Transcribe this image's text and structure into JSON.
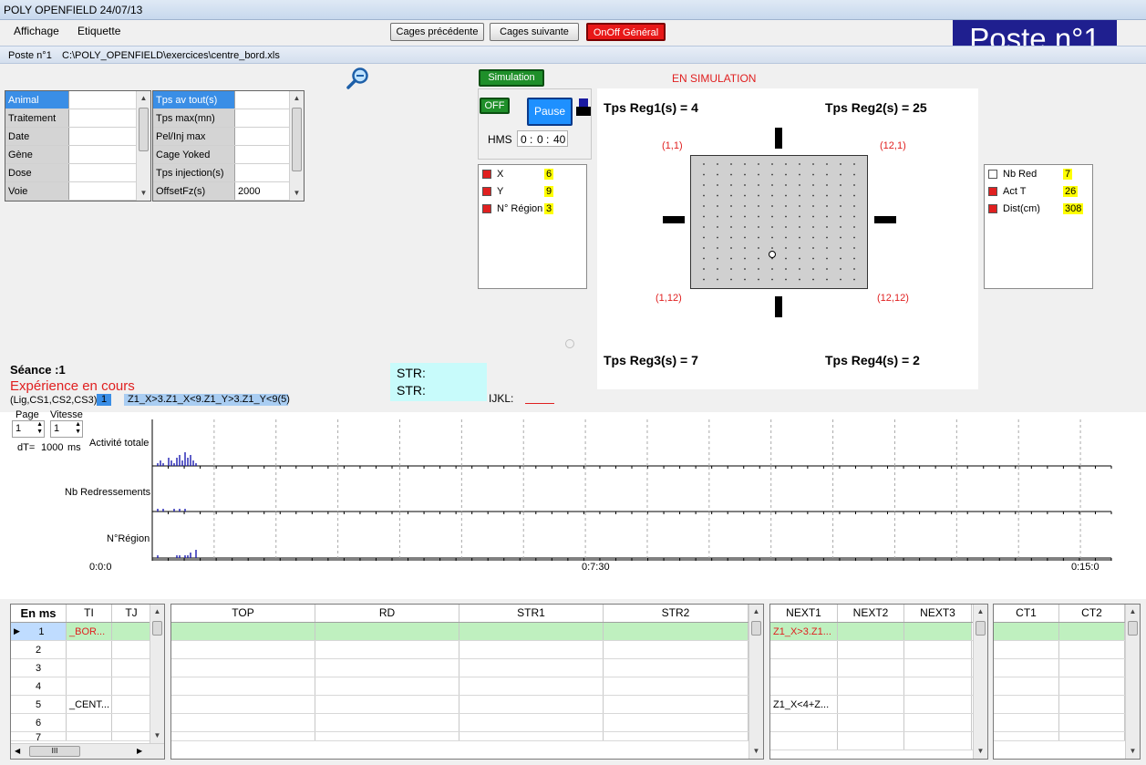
{
  "window": {
    "title": "POLY OPENFIELD 24/07/13"
  },
  "menu": {
    "items": [
      "Affichage",
      "Etiquette"
    ]
  },
  "toolbar": {
    "prev_label": "Cages précédente",
    "next_label": "Cages suivante",
    "onoff_label": "OnOff Général"
  },
  "poste_badge": "Poste n°1",
  "pathbar": {
    "poste": "Poste n°1",
    "path": "C:\\POLY_OPENFIELD\\exercices\\centre_bord.xls"
  },
  "animal_table": [
    {
      "key": "Animal",
      "value": ""
    },
    {
      "key": "Traitement",
      "value": ""
    },
    {
      "key": "Date",
      "value": ""
    },
    {
      "key": "Gène",
      "value": ""
    },
    {
      "key": "Dose",
      "value": ""
    },
    {
      "key": "Voie",
      "value": ""
    }
  ],
  "params_table": [
    {
      "key": "Tps av tout(s)",
      "value": ""
    },
    {
      "key": "Tps max(mn)",
      "value": ""
    },
    {
      "key": "Pel/Inj max",
      "value": ""
    },
    {
      "key": "Cage Yoked",
      "value": ""
    },
    {
      "key": "Tps injection(s)",
      "value": ""
    },
    {
      "key": "OffsetFz(s)",
      "value": "2000"
    }
  ],
  "sim": {
    "button_label": "Simulation",
    "status": "EN SIMULATION",
    "off_label": "OFF",
    "pause_label": "Pause",
    "hms_label": "HMS",
    "h": "0",
    "m": "0",
    "s": "40"
  },
  "coords": [
    {
      "label": "X",
      "value": "6"
    },
    {
      "label": "Y",
      "value": "9"
    },
    {
      "label": "N° Région",
      "value": "3"
    }
  ],
  "stats": [
    {
      "label": "Nb Red",
      "value": "7",
      "checked": false
    },
    {
      "label": "Act T",
      "value": "26",
      "checked": true
    },
    {
      "label": "Dist(cm)",
      "value": "308",
      "checked": true
    }
  ],
  "regions": {
    "tps1": "Tps Reg1(s)  =  4",
    "tps2": "Tps Reg2(s)  =  25",
    "tps3": "Tps Reg3(s)  =  7",
    "tps4": "Tps Reg4(s)  =  2",
    "c11": "(1,1)",
    "c121": "(12,1)",
    "c112": "(1,12)",
    "c1212": "(12,12)"
  },
  "seance": {
    "label": "Séance :1",
    "status": "Expérience en cours",
    "lig_label": "(Lig,CS1,CS2,CS3)",
    "lig_value": "1",
    "condition": "Z1_X>3.Z1_X<9.Z1_Y>3.Z1_Y<9(5)",
    "str1": "STR:",
    "str2": "STR:",
    "ijkl": "IJKL:"
  },
  "page_ctrl": {
    "page_label": "Page",
    "page_value": "1",
    "vitesse_label": "Vitesse",
    "vitesse_value": "1",
    "dt_label": "dT=",
    "dt_value": "1000",
    "dt_unit": "ms"
  },
  "chart_data": {
    "type": "bar",
    "x_ticks": [
      "0:0:0",
      "0:7:30",
      "0:15:0"
    ],
    "series": [
      {
        "name": "Activité totale",
        "values": [
          1,
          2,
          1,
          0,
          3,
          2,
          1,
          3,
          4,
          2,
          5,
          3,
          4,
          2,
          1
        ]
      },
      {
        "name": "Nb Redressements",
        "values": [
          1,
          0,
          1,
          0,
          0,
          0,
          1,
          0,
          1,
          0,
          1,
          0,
          0,
          0,
          0
        ]
      },
      {
        "name": "N°Région",
        "values": [
          1,
          0,
          0,
          0,
          0,
          0,
          0,
          1,
          1,
          0,
          1,
          1,
          2,
          0,
          3
        ]
      }
    ]
  },
  "table_a": {
    "corner": "En ms",
    "headers": [
      "TI",
      "TJ"
    ],
    "rows": [
      [
        "1",
        "_BOR...",
        ""
      ],
      [
        "2",
        "",
        ""
      ],
      [
        "3",
        "",
        ""
      ],
      [
        "4",
        "",
        ""
      ],
      [
        "5",
        "_CENT...",
        ""
      ],
      [
        "6",
        "",
        ""
      ],
      [
        "7",
        "",
        ""
      ]
    ]
  },
  "table_b": {
    "headers": [
      "TOP",
      "RD",
      "STR1",
      "STR2"
    ]
  },
  "table_c": {
    "headers": [
      "NEXT1",
      "NEXT2",
      "NEXT3"
    ],
    "rows": [
      [
        "Z1_X>3.Z1...",
        "",
        ""
      ],
      [
        "",
        "",
        ""
      ],
      [
        "",
        "",
        ""
      ],
      [
        "",
        "",
        ""
      ],
      [
        "Z1_X<4+Z...",
        "",
        ""
      ],
      [
        "",
        "",
        ""
      ],
      [
        "",
        "",
        ""
      ]
    ]
  },
  "table_d": {
    "headers": [
      "CT1",
      "CT2"
    ]
  },
  "hscroll_glyph": "III"
}
